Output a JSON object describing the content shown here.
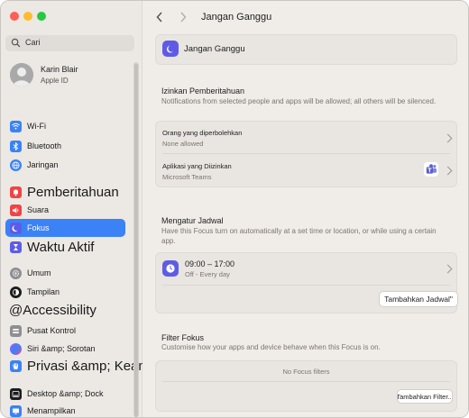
{
  "window": {
    "title": "Jangan Ganggu"
  },
  "sidebar": {
    "search_placeholder": "Cari",
    "user": {
      "name": "Karin Blair",
      "subtitle": "Apple ID"
    },
    "items": [
      {
        "label": "Wi-Fi"
      },
      {
        "label": "Bluetooth"
      },
      {
        "label": "Jaringan"
      },
      {
        "label": "Pemberitahuan"
      },
      {
        "label": "Suara"
      },
      {
        "label": "Fokus"
      },
      {
        "label": "Waktu Aktif"
      },
      {
        "label": "Umum"
      },
      {
        "label": "Tampilan"
      },
      {
        "label": "@Accessibility"
      },
      {
        "label": "Pusat Kontrol"
      },
      {
        "label": "Siri &amp; Sorotan"
      },
      {
        "label": "Privasi &amp; Keamanan"
      },
      {
        "label": "Desktop &amp; Dock"
      },
      {
        "label": "Menampilkan"
      }
    ]
  },
  "main": {
    "header_title": "Jangan Ganggu",
    "focus_name": "Jangan Ganggu",
    "notifications": {
      "heading": "Izinkan Pemberitahuan",
      "description": "Notifications from selected people and apps will be allowed; all others will be silenced.",
      "people_title": "Orang  yang diperbolehkan",
      "people_value": "None allowed",
      "apps_title": "Aplikasi yang Diizinkan",
      "apps_value": "Microsoft Teams"
    },
    "schedule": {
      "heading": "Mengatur Jadwal",
      "description": "Have this Focus turn on automatically at a set time or location, or while using a certain app.",
      "item_time": "09:00 – 17:00",
      "item_days": "Off - Every day",
      "add_button": "Tambahkan Jadwal\""
    },
    "filters": {
      "heading": "Filter Fokus",
      "description": "Customise how your apps and device behave when this Focus is on.",
      "empty_text": "No Focus filters",
      "add_button": "Tambahkan Filter..."
    }
  },
  "colors": {
    "accent": "#3b82f6",
    "focus_purple": "#5e5ce6",
    "teams_purple": "#5b5fc7"
  }
}
